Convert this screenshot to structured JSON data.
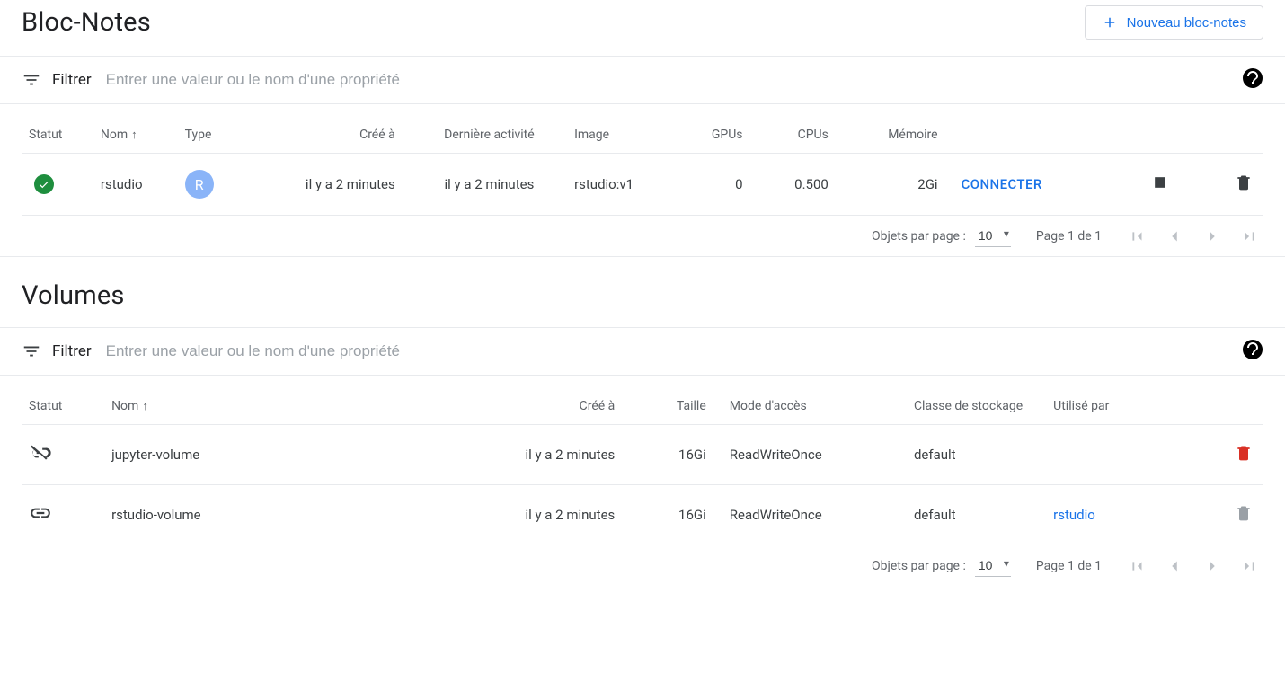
{
  "notebooks": {
    "title": "Bloc-Notes",
    "new_button_label": "Nouveau bloc-notes",
    "filter_label": "Filtrer",
    "filter_placeholder": "Entrer une valeur ou le nom d'une propriété",
    "headers": {
      "status": "Statut",
      "name": "Nom",
      "type": "Type",
      "created": "Créé à",
      "last_activity": "Dernière activité",
      "image": "Image",
      "gpus": "GPUs",
      "cpus": "CPUs",
      "memory": "Mémoire"
    },
    "rows": [
      {
        "name": "rstudio",
        "type_badge": "R",
        "created": "il y a 2 minutes",
        "last_activity": "il y a 2 minutes",
        "image": "rstudio:v1",
        "gpus": "0",
        "cpus": "0.500",
        "memory": "2Gi",
        "connect_label": "CONNECTER"
      }
    ],
    "pager": {
      "items_per_page_label": "Objets par page :",
      "items_per_page_value": "10",
      "page_label": "Page 1 de 1"
    }
  },
  "volumes": {
    "title": "Volumes",
    "filter_label": "Filtrer",
    "filter_placeholder": "Entrer une valeur ou le nom d'une propriété",
    "headers": {
      "status": "Statut",
      "name": "Nom",
      "created": "Créé à",
      "size": "Taille",
      "access_mode": "Mode d'accès",
      "storage_class": "Classe de stockage",
      "used_by": "Utilisé par"
    },
    "rows": [
      {
        "linked": false,
        "name": "jupyter-volume",
        "created": "il y a 2 minutes",
        "size": "16Gi",
        "access_mode": "ReadWriteOnce",
        "storage_class": "default",
        "used_by": "",
        "delete_color": "#d93025"
      },
      {
        "linked": true,
        "name": "rstudio-volume",
        "created": "il y a 2 minutes",
        "size": "16Gi",
        "access_mode": "ReadWriteOnce",
        "storage_class": "default",
        "used_by": "rstudio",
        "delete_color": "#9aa0a6"
      }
    ],
    "pager": {
      "items_per_page_label": "Objets par page :",
      "items_per_page_value": "10",
      "page_label": "Page 1 de 1"
    }
  }
}
